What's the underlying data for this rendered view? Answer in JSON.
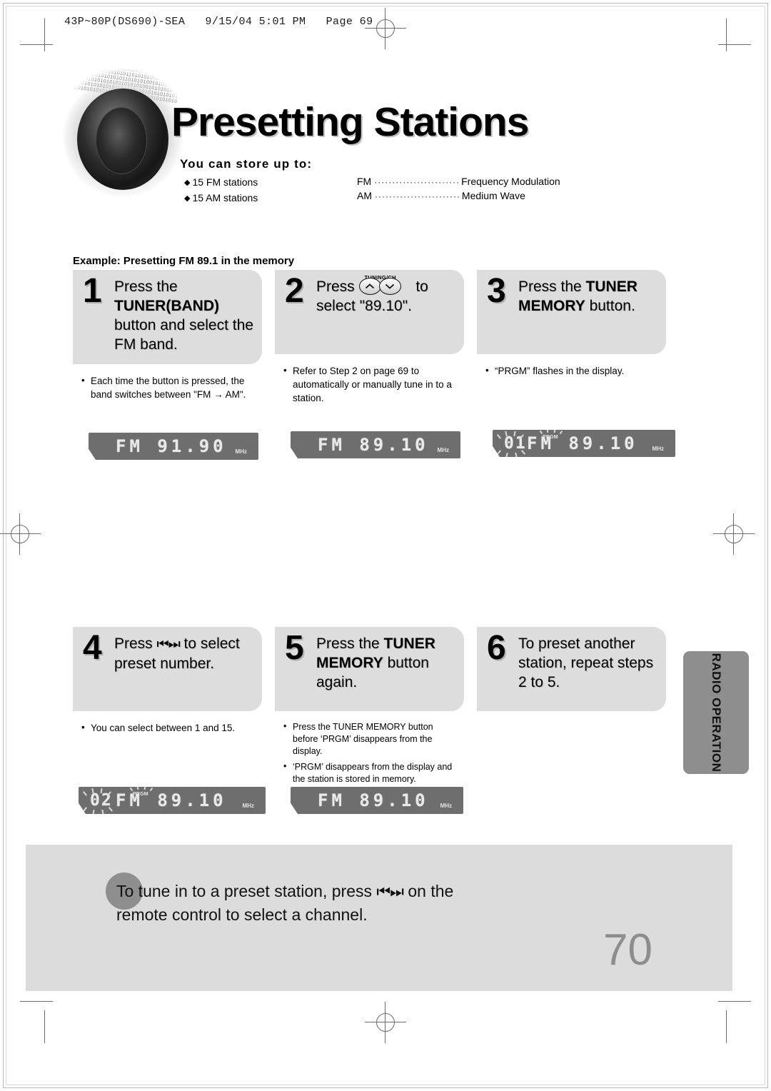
{
  "print_header": "43P~80P(DS690)-SEA   9/15/04 5:01 PM   Page 69",
  "title": "Presetting Stations",
  "store": {
    "heading": "You can store up to:",
    "items": [
      "15 FM stations",
      "15 AM stations"
    ],
    "abbreviations": [
      {
        "code": "FM",
        "dots": "························",
        "meaning": "Frequency Modulation"
      },
      {
        "code": "AM",
        "dots": "························",
        "meaning": "Medium Wave"
      }
    ]
  },
  "example_label": "Example: Presetting FM 89.1 in the memory",
  "steps": [
    {
      "number": "1",
      "head_plain_1": "Press the ",
      "head_bold": "TUNER(BAND)",
      "head_plain_2": " button  and select the FM band.",
      "bullets": [
        "Each time the button is pressed, the band switches between \"FM → AM\"."
      ],
      "display": {
        "preset": "",
        "prgm": "",
        "band": "FM",
        "freq": "91.90",
        "unit": "MHz",
        "flashing": false
      }
    },
    {
      "number": "2",
      "head_plain_1": "Press ",
      "icon_label": "TUNING/CH",
      "head_plain_2": " to select \"89.10\".",
      "bullets": [
        "Refer to Step 2 on page 69 to automatically or manually tune in to a station."
      ],
      "display": {
        "preset": "",
        "prgm": "",
        "band": "FM",
        "freq": "89.10",
        "unit": "MHz",
        "flashing": false
      }
    },
    {
      "number": "3",
      "head_plain_1": "Press the ",
      "head_bold": "TUNER MEMORY",
      "head_plain_2": " button.",
      "bullets": [
        "“PRGM” flashes in the display."
      ],
      "display": {
        "preset": "01",
        "prgm": "PRGM",
        "band": "FM",
        "freq": "89.10",
        "unit": "MHz",
        "flashing": true
      }
    },
    {
      "number": "4",
      "head_plain_1": "Press ",
      "icon_label": "",
      "head_plain_2": " to select preset number.",
      "bullets": [
        "You can select between 1 and 15."
      ],
      "display": {
        "preset": "02",
        "prgm": "PRGM",
        "band": "FM",
        "freq": "89.10",
        "unit": "MHz",
        "flashing": true
      }
    },
    {
      "number": "5",
      "head_plain_1": "Press the ",
      "head_bold": "TUNER MEMORY",
      "head_plain_2": " button again.",
      "bullets": [
        "Press the TUNER MEMORY button before ‘PRGM’ disappears from the display.",
        "‘PRGM’ disappears from the display and the station is stored in memory."
      ],
      "bullet5_bold": "TUNER MEMORY",
      "display": {
        "preset": "",
        "prgm": "",
        "band": "FM",
        "freq": "89.10",
        "unit": "MHz",
        "flashing": false
      }
    },
    {
      "number": "6",
      "head_plain_1": "To preset another station, repeat steps 2 to 5.",
      "bullets": [],
      "display": null
    }
  ],
  "side_tab": "RADIO OPERATION",
  "note": {
    "line1_a": "To tune in to a preset station, press ",
    "icon": "prev-next-track",
    "line1_b": " on the",
    "line2": "remote control to select a channel."
  },
  "page_number": "70",
  "bit_pattern": "010101010010101010101011010101001010101010101101010100101010101010110101010010101010101011010101001010101010101101010100101010101010110101010010101010101011010101001010101010101101010100101010101010110101010010101010101011010101001010101010101101010100101010101010",
  "colors": {
    "lcd_bg": "#6e6e6e",
    "step_head_bg": "#dddddd",
    "note_band": "#dcdcdc",
    "side_tab": "#8e8e8e",
    "page_number": "#8d8d8d"
  }
}
